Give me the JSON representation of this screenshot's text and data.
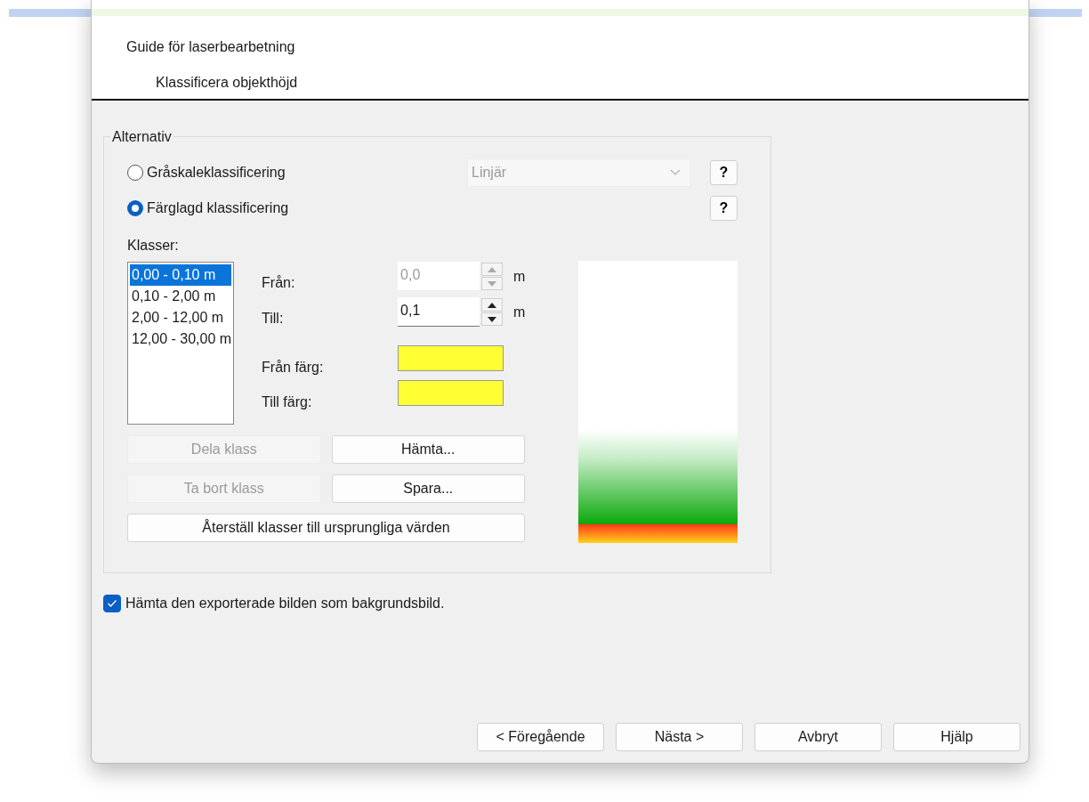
{
  "wizard": {
    "title": "Guide för laserbearbetning",
    "step": "Klassificera objekthöjd"
  },
  "options": {
    "legend": "Alternativ",
    "modes": [
      {
        "label": "Gråskaleklassificering",
        "selected": false,
        "help": "?"
      },
      {
        "label": "Färglagd klassificering",
        "selected": true,
        "help": "?"
      }
    ],
    "curve_dropdown": {
      "value": "Linjär",
      "disabled": true
    },
    "classes_label": "Klasser:",
    "classes": [
      {
        "label": "0,00 - 0,10 m",
        "selected": true
      },
      {
        "label": "0,10 - 2,00 m",
        "selected": false
      },
      {
        "label": "2,00 - 12,00 m",
        "selected": false
      },
      {
        "label": "12,00 - 30,00 m",
        "selected": false
      }
    ],
    "range_fields": [
      {
        "label": "Från:",
        "value": "0,0",
        "unit": "m",
        "disabled": true
      },
      {
        "label": "Till:",
        "value": "0,1",
        "unit": "m",
        "disabled": false
      }
    ],
    "color_fields": [
      {
        "label": "Från färg:",
        "color": "#ffff33"
      },
      {
        "label": "Till färg:",
        "color": "#ffff33"
      }
    ],
    "button_rows": [
      [
        {
          "label": "Dela klass",
          "disabled": true
        },
        {
          "label": "Hämta...",
          "disabled": false
        }
      ],
      [
        {
          "label": "Ta bort klass",
          "disabled": true
        },
        {
          "label": "Spara...",
          "disabled": false
        }
      ],
      [
        {
          "label": "Återställ klasser till ursprungliga värden",
          "disabled": false
        }
      ]
    ]
  },
  "background_option": {
    "label": "Hämta den exporterade bilden som bakgrundsbild.",
    "checked": true
  },
  "nav_buttons": [
    "< Föregående",
    "Nästa >",
    "Avbryt",
    "Hjälp"
  ]
}
